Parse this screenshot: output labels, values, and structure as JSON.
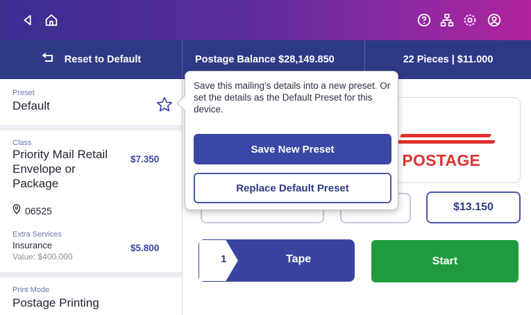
{
  "nav": {
    "back_icon": "back-arrow-icon",
    "home_icon": "home-icon",
    "help_icon": "help-icon",
    "network_icon": "network-icon",
    "settings_icon": "settings-icon",
    "account_icon": "account-icon"
  },
  "infobar": {
    "reset_label": "Reset to Default",
    "balance_label": "Postage Balance $28,149.850",
    "pieces_label": "22 Pieces | $11.000"
  },
  "left": {
    "preset_label": "Preset",
    "preset_value": "Default",
    "class_label": "Class",
    "class_value_line1": "Priority Mail Retail",
    "class_value_line2": "Envelope or",
    "class_value_line3": "Package",
    "class_price": "$7.350",
    "zip": "06525",
    "extra_label": "Extra Services",
    "extra_name": "Insurance",
    "extra_price": "$5.800",
    "extra_value": "Value: $400.000",
    "print_mode_label": "Print Mode",
    "print_mode_value": "Postage Printing"
  },
  "main": {
    "postage_text": "S POSTAGE",
    "amount": "$13.150",
    "tape_qty": "1",
    "tape_label": "Tape",
    "start_label": "Start"
  },
  "popover": {
    "message": "Save this mailing's details into a new preset. Or set the details as the Default Preset for this device.",
    "save_new_label": "Save New Preset",
    "replace_default_label": "Replace Default Preset"
  },
  "colors": {
    "nav_gradient_start": "#3a2e8f",
    "nav_gradient_end": "#b0239c",
    "infobar_bg": "#2f3a86",
    "primary_blue": "#3a44a0",
    "start_green": "#1f9a3c",
    "postage_red": "#e0312f"
  }
}
